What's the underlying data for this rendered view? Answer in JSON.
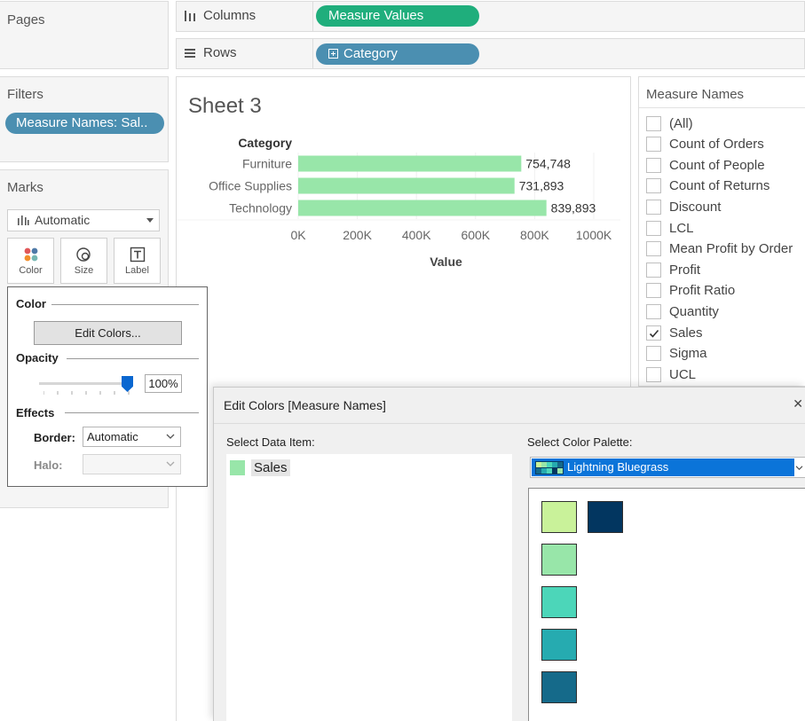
{
  "shelves": {
    "pages_title": "Pages",
    "filters_title": "Filters",
    "filter_pill": "Measure Names: Sal..",
    "marks_title": "Marks",
    "columns_label": "Columns",
    "rows_label": "Rows",
    "columns_pill": "Measure Values",
    "rows_pill": "Category"
  },
  "marks": {
    "type": "Automatic",
    "color_label": "Color",
    "size_label": "Size",
    "label_label": "Label"
  },
  "color_popup": {
    "color_section": "Color",
    "edit_button": "Edit Colors...",
    "opacity_section": "Opacity",
    "opacity_value": "100%",
    "opacity_fraction": 1.0,
    "effects_section": "Effects",
    "border_label": "Border:",
    "border_value": "Automatic",
    "halo_label": "Halo:",
    "halo_value": ""
  },
  "sheet": {
    "title": "Sheet 3"
  },
  "chart_data": {
    "type": "bar",
    "orientation": "horizontal",
    "row_header": "Category",
    "categories": [
      "Furniture",
      "Office Supplies",
      "Technology"
    ],
    "values": [
      754748,
      731893,
      839893
    ],
    "value_labels": [
      "754,748",
      "731,893",
      "839,893"
    ],
    "xlabel": "Value",
    "xlim": [
      0,
      1000000
    ],
    "xticks": [
      0,
      200000,
      400000,
      600000,
      800000,
      1000000
    ],
    "xtick_labels": [
      "0K",
      "200K",
      "400K",
      "600K",
      "800K",
      "1000K"
    ],
    "bar_color": "#98e6a9"
  },
  "legend": {
    "title": "Measure Names",
    "items": [
      {
        "label": "(All)",
        "checked": false
      },
      {
        "label": "Count of Orders",
        "checked": false
      },
      {
        "label": "Count of People",
        "checked": false
      },
      {
        "label": "Count of Returns",
        "checked": false
      },
      {
        "label": "Discount",
        "checked": false
      },
      {
        "label": "LCL",
        "checked": false
      },
      {
        "label": "Mean Profit by Order",
        "checked": false
      },
      {
        "label": "Profit",
        "checked": false
      },
      {
        "label": "Profit Ratio",
        "checked": false
      },
      {
        "label": "Quantity",
        "checked": false
      },
      {
        "label": "Sales",
        "checked": true
      },
      {
        "label": "Sigma",
        "checked": false
      },
      {
        "label": "UCL",
        "checked": false
      }
    ]
  },
  "edit_colors_dialog": {
    "title": "Edit Colors [Measure Names]",
    "close_glyph": "✕",
    "select_item_label": "Select Data Item:",
    "items": [
      {
        "label": "Sales",
        "color": "#98e6a9"
      }
    ],
    "select_palette_label": "Select Color Palette:",
    "palette_name": "Lightning Bluegrass",
    "palette_colors": [
      "#c9f29a",
      "#023660",
      "#98e6a9",
      "#4cd6b9",
      "#26abb0",
      "#156a8a"
    ]
  }
}
